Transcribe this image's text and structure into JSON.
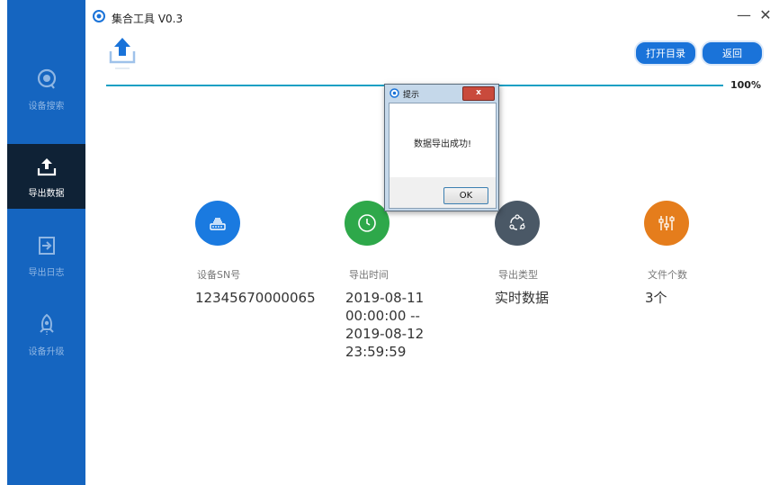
{
  "app": {
    "title": "集合工具 V0.3"
  },
  "window": {
    "minimize": "—",
    "close": "✕"
  },
  "sidebar": {
    "items": [
      {
        "label": "设备搜索",
        "icon": "search-icon",
        "active": false
      },
      {
        "label": "导出数据",
        "icon": "export-icon",
        "active": true
      },
      {
        "label": "导出日志",
        "icon": "log-export-icon",
        "active": false
      },
      {
        "label": "设备升级",
        "icon": "rocket-icon",
        "active": false
      }
    ]
  },
  "toolbar": {
    "open_dir": "打开目录",
    "back": "返回"
  },
  "progress": {
    "value": 1.0,
    "label": "100%"
  },
  "stats": [
    {
      "label": "设备SN号",
      "value": "12345670000065",
      "icon": "device-icon",
      "color": "#1a7ae0"
    },
    {
      "label": "导出时间",
      "value": "2019-08-11\n00:00:00 --\n2019-08-12\n23:59:59",
      "icon": "clock-icon",
      "color": "#2ea84a"
    },
    {
      "label": "导出类型",
      "value": "实时数据",
      "icon": "share-icon",
      "color": "#4a5866"
    },
    {
      "label": "文件个数",
      "value": "3个",
      "icon": "sliders-icon",
      "color": "#e57d1c"
    }
  ],
  "dialog": {
    "title": "提示",
    "message": "数据导出成功!",
    "ok": "OK"
  },
  "colors": {
    "sidebar": "#1565c0",
    "sidebar_active": "#0f2236",
    "accent": "#1a73d9"
  }
}
